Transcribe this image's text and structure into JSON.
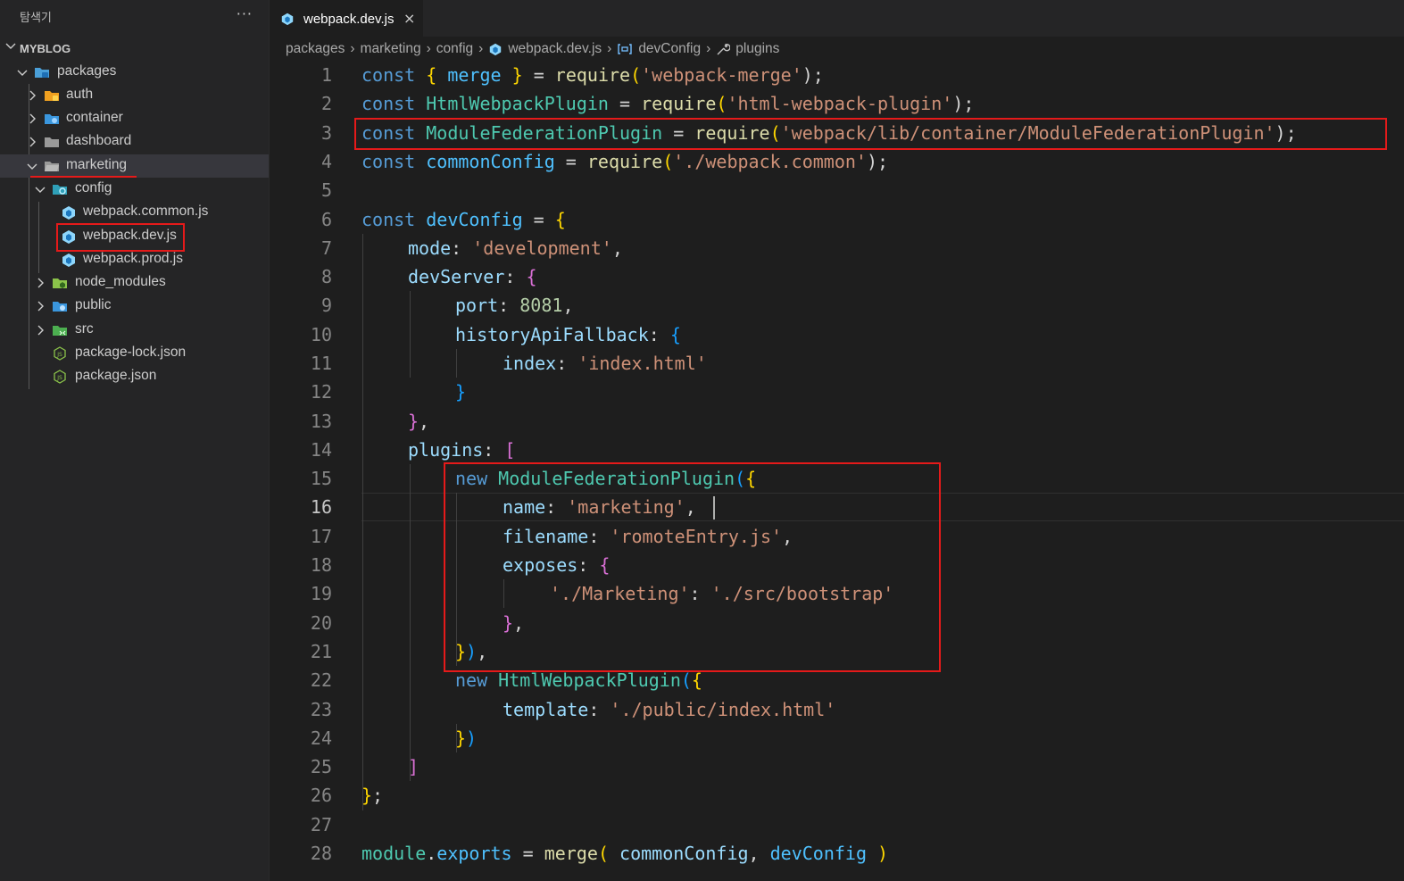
{
  "explorer": {
    "title": "탐색기",
    "more": "···",
    "root": "MYBLOG",
    "items": [
      {
        "label": "packages"
      },
      {
        "label": "auth"
      },
      {
        "label": "container"
      },
      {
        "label": "dashboard"
      },
      {
        "label": "marketing"
      },
      {
        "label": "config"
      },
      {
        "label": "webpack.common.js"
      },
      {
        "label": "webpack.dev.js"
      },
      {
        "label": "webpack.prod.js"
      },
      {
        "label": "node_modules"
      },
      {
        "label": "public"
      },
      {
        "label": "src"
      },
      {
        "label": "package-lock.json"
      },
      {
        "label": "package.json"
      }
    ]
  },
  "tab": {
    "label": "webpack.dev.js",
    "close": "×"
  },
  "breadcrumbs": [
    "packages",
    "marketing",
    "config",
    "webpack.dev.js",
    "devConfig",
    "plugins"
  ],
  "line_numbers": [
    "1",
    "2",
    "3",
    "4",
    "5",
    "6",
    "7",
    "8",
    "9",
    "10",
    "11",
    "12",
    "13",
    "14",
    "15",
    "16",
    "17",
    "18",
    "19",
    "20",
    "21",
    "22",
    "23",
    "24",
    "25",
    "26",
    "27",
    "28"
  ],
  "active_line": "16",
  "code": {
    "l1": [
      "const",
      " ",
      "{",
      " merge ",
      "}",
      " = ",
      "require",
      "(",
      "'webpack-merge'",
      ");"
    ],
    "l2": [
      "const",
      " ",
      "HtmlWebpackPlugin",
      " = ",
      "require",
      "(",
      "'html-webpack-plugin'",
      ");"
    ],
    "l3": [
      "const",
      " ",
      "ModuleFederationPlugin",
      " = ",
      "require",
      "(",
      "'webpack/lib/container/ModuleFederationPlugin'",
      ");"
    ],
    "l4": [
      "const",
      " ",
      "commonConfig",
      " = ",
      "require",
      "(",
      "'./webpack.common'",
      ");"
    ],
    "l6": [
      "const",
      " ",
      "devConfig",
      " = ",
      "{"
    ],
    "l7": [
      "mode",
      ": ",
      "'development'",
      ","
    ],
    "l8": [
      "devServer",
      ": ",
      "{"
    ],
    "l9": [
      "port",
      ": ",
      "8081",
      ","
    ],
    "l10": [
      "historyApiFallback",
      ": ",
      "{"
    ],
    "l11": [
      "index",
      ": ",
      "'index.html'"
    ],
    "l12": [
      "}"
    ],
    "l13": [
      "}",
      ","
    ],
    "l14": [
      "plugins",
      ": ",
      "["
    ],
    "l15": [
      "new",
      " ",
      "ModuleFederationPlugin",
      "(",
      "{"
    ],
    "l16": [
      "name",
      ": ",
      "'marketing'",
      ","
    ],
    "l17": [
      "filename",
      ": ",
      "'romoteEntry.js'",
      ","
    ],
    "l18": [
      "exposes",
      ": ",
      "{"
    ],
    "l19": [
      "'./Marketing'",
      ": ",
      "'./src/bootstrap'"
    ],
    "l20": [
      "}",
      ","
    ],
    "l21": [
      "}",
      ")",
      ","
    ],
    "l22": [
      "new",
      " ",
      "HtmlWebpackPlugin",
      "(",
      "{"
    ],
    "l23": [
      "template",
      ": ",
      "'./public/index.html'"
    ],
    "l24": [
      "}",
      ")"
    ],
    "l25": [
      "]"
    ],
    "l26": [
      "}",
      ";"
    ],
    "l28": [
      "module",
      ".",
      "exports",
      " = ",
      "merge",
      "(",
      " ",
      "commonConfig",
      ", ",
      "devConfig",
      " ",
      ")"
    ]
  },
  "colors": {
    "highlight": "#e51a1a",
    "keyword": "#569cd6",
    "class": "#4ec9b0",
    "string": "#ce9178"
  }
}
